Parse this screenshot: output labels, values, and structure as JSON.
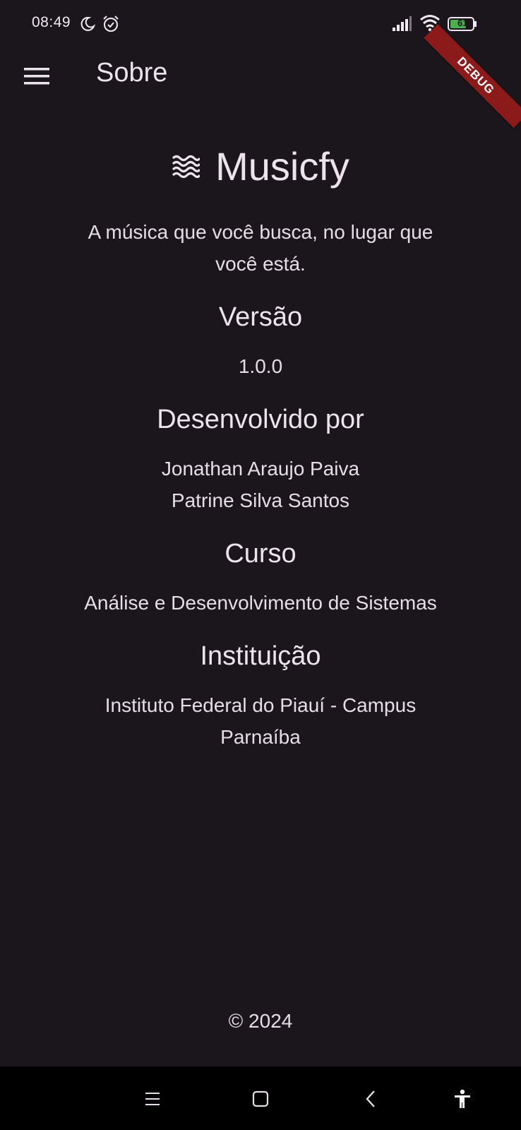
{
  "status_bar": {
    "time": "08:49",
    "battery": "61",
    "icons": [
      "moon-icon",
      "alarm-icon",
      "signal-icon",
      "wifi-icon",
      "battery-icon"
    ]
  },
  "debug_banner": "DEBUG",
  "app_bar": {
    "title": "Sobre",
    "menu_icon": "hamburger-menu-icon"
  },
  "about": {
    "app_name": "Musicfy",
    "logo_icon": "waves-icon",
    "tagline": "A música que você busca, no lugar que você está.",
    "sections": [
      {
        "title": "Versão",
        "lines": [
          "1.0.0"
        ]
      },
      {
        "title": "Desenvolvido por",
        "lines": [
          "Jonathan Araujo Paiva",
          "Patrine Silva Santos"
        ]
      },
      {
        "title": "Curso",
        "lines": [
          "Análise e Desenvolvimento de Sistemas"
        ]
      },
      {
        "title": "Instituição",
        "lines": [
          "Instituto Federal do Piauí - Campus Parnaíba"
        ]
      }
    ],
    "copyright": "© 2024"
  },
  "nav_bar": {
    "icons": [
      "recents-icon",
      "home-icon",
      "back-icon",
      "accessibility-icon"
    ]
  },
  "colors": {
    "background": "#1a161b",
    "text": "#e9e0ea",
    "debug_banner": "#8d1a1a",
    "battery": "#4caf50",
    "nav_bar": "#000000"
  }
}
